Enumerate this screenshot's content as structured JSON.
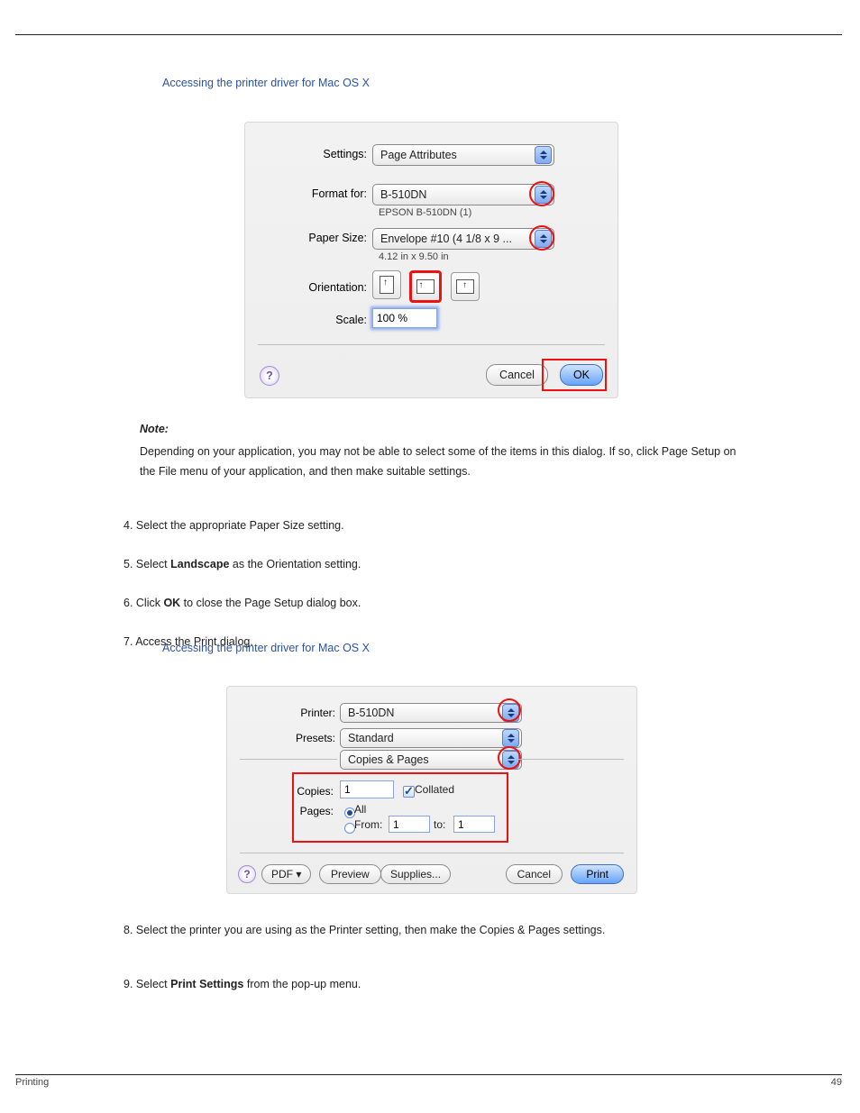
{
  "header": {
    "line": true
  },
  "sec1": {
    "intro": "Accessing the printer driver for Mac OS X",
    "dlg": {
      "settings": {
        "label": "Settings:",
        "value": "Page Attributes"
      },
      "format_for": {
        "label": "Format for:",
        "value": "B-510DN",
        "sub": "EPSON B-510DN (1)"
      },
      "paper_size": {
        "label": "Paper Size:",
        "value": "Envelope #10 (4 1/8 x 9 ...",
        "sub": "4.12 in x 9.50 in"
      },
      "orientation": {
        "label": "Orientation:"
      },
      "scale": {
        "label": "Scale:",
        "value": "100 %"
      },
      "cancel": "Cancel",
      "ok": "OK"
    },
    "note_label": "Note:",
    "note": "Depending on your application, you may not be able to select some of the items in this dialog. If so, click Page Setup on the File menu of your application, and then make suitable settings.",
    "step4": "4. Select the appropriate Paper Size setting.",
    "step5": {
      "pre": "5. Select ",
      "landscape": "Landscape",
      "post": " as the Orientation setting."
    },
    "step6": {
      "pre": "6. Click ",
      "ok": "OK",
      "post": " to close the Page Setup dialog box."
    },
    "step7": "7. Access the Print dialog."
  },
  "sec2": {
    "intro": "Accessing the printer driver for Mac OS X",
    "dlg": {
      "printer": {
        "label": "Printer:",
        "value": "B-510DN"
      },
      "presets": {
        "label": "Presets:",
        "value": "Standard"
      },
      "panel": {
        "value": "Copies & Pages"
      },
      "copies": {
        "label": "Copies:",
        "value": "1",
        "collated": "Collated"
      },
      "pages": {
        "label": "Pages:",
        "all": "All",
        "from_lbl": "From:",
        "from": "1",
        "to_lbl": "to:",
        "to": "1"
      },
      "pdf": "PDF ▾",
      "preview": "Preview",
      "supplies": "Supplies...",
      "cancel": "Cancel",
      "print": "Print"
    },
    "step8": "8. Select the printer you are using as the Printer setting, then make the Copies & Pages settings.",
    "step9": {
      "pre": "9. Select ",
      "ps": "Print Settings",
      "post": " from the pop-up menu."
    }
  },
  "footer": {
    "left": "Printing",
    "right": "49"
  }
}
